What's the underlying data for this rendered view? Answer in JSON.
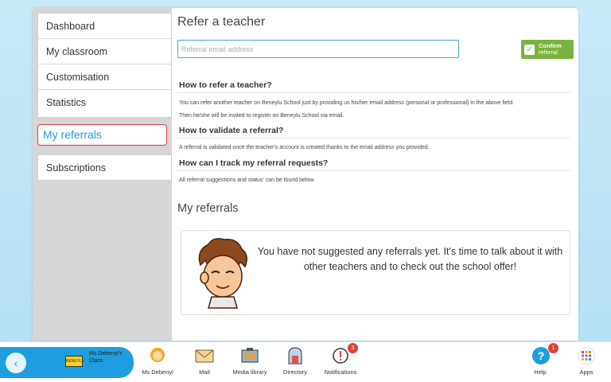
{
  "sidebar": {
    "items": [
      "Dashboard",
      "My classroom",
      "Customisation",
      "Statistics"
    ],
    "active": "My referrals",
    "extra": "Subscriptions"
  },
  "main": {
    "title": "Refer a teacher",
    "email_placeholder": "Referral email address",
    "confirm_line1": "Confirm",
    "confirm_line2": "referral",
    "sections": [
      {
        "heading": "How to refer a teacher?",
        "p1": "You can refer another teacher on Beneylu School just by providing us his/her email address (personal or professional) in the above field.",
        "p2": "Then he/she will be invited to register on Beneylu School via email."
      },
      {
        "heading": "How to validate a referral?",
        "p1": "A referral is validated once the teacher's account is created thanks to the email address you provided.",
        "p2": ""
      },
      {
        "heading": "How can I track my referral requests?",
        "p1": "All referral suggestions and status' can be found below.",
        "p2": ""
      }
    ],
    "subtitle": "My referrals",
    "empty_text": "You have not suggested any referrals yet. It's time to talk about it with other teachers and to check out the school offer!"
  },
  "bottom": {
    "class_badge": "BENEYLU",
    "class_name": "Ms Debenyl's Class",
    "nav": [
      {
        "label": "Ms Debenyl",
        "icon": "avatar-icon"
      },
      {
        "label": "Mail",
        "icon": "mail-icon"
      },
      {
        "label": "Media library",
        "icon": "media-library-icon"
      },
      {
        "label": "Directory",
        "icon": "directory-icon"
      },
      {
        "label": "Notifications",
        "icon": "notifications-icon",
        "badge": "3"
      }
    ],
    "help": {
      "label": "Help",
      "badge": "1"
    },
    "apps": {
      "label": "Apps"
    }
  },
  "colors": {
    "accent": "#1e9ee0",
    "confirm": "#7ab33c",
    "highlight_border": "#e03b3b",
    "badge": "#e2403a"
  }
}
